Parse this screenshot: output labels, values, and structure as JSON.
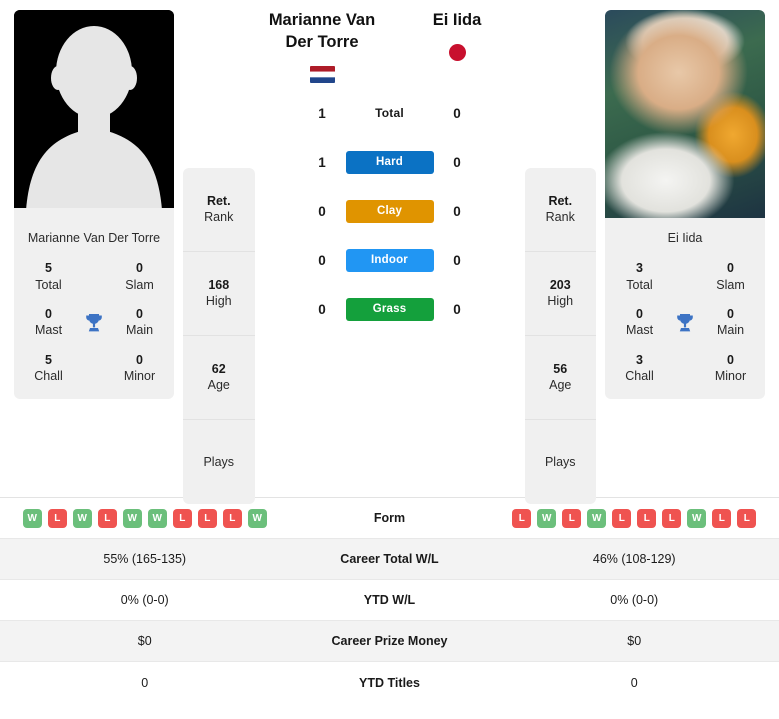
{
  "players": {
    "left": {
      "name": "Marianne Van Der Torre",
      "card_name": "Marianne Van Der Torre",
      "flag": "netherlands-flag",
      "photo": "placeholder-avatar",
      "titles": {
        "total": "5",
        "total_label": "Total",
        "slam": "0",
        "slam_label": "Slam",
        "mast": "0",
        "mast_label": "Mast",
        "main": "0",
        "main_label": "Main",
        "chall": "5",
        "chall_label": "Chall",
        "minor": "0",
        "minor_label": "Minor"
      },
      "info": [
        {
          "value": "Ret.",
          "label": "Rank"
        },
        {
          "value": "168",
          "label": "High"
        },
        {
          "value": "62",
          "label": "Age"
        },
        {
          "value": "",
          "label": "Plays"
        }
      ],
      "form": [
        "W",
        "L",
        "W",
        "L",
        "W",
        "W",
        "L",
        "L",
        "L",
        "W"
      ],
      "career_wl": "55% (165-135)",
      "ytd_wl": "0% (0-0)",
      "prize_money": "$0",
      "ytd_titles": "0"
    },
    "right": {
      "name": "Ei Iida",
      "card_name": "Ei Iida",
      "flag": "japan-flag",
      "photo": "player-photo",
      "titles": {
        "total": "3",
        "total_label": "Total",
        "slam": "0",
        "slam_label": "Slam",
        "mast": "0",
        "mast_label": "Mast",
        "main": "0",
        "main_label": "Main",
        "chall": "3",
        "chall_label": "Chall",
        "minor": "0",
        "minor_label": "Minor"
      },
      "info": [
        {
          "value": "Ret.",
          "label": "Rank"
        },
        {
          "value": "203",
          "label": "High"
        },
        {
          "value": "56",
          "label": "Age"
        },
        {
          "value": "",
          "label": "Plays"
        }
      ],
      "form": [
        "L",
        "W",
        "L",
        "W",
        "L",
        "L",
        "L",
        "W",
        "L",
        "L"
      ],
      "career_wl": "46% (108-129)",
      "ytd_wl": "0% (0-0)",
      "prize_money": "$0",
      "ytd_titles": "0"
    }
  },
  "surfaces": [
    {
      "label": "Total",
      "left": "1",
      "right": "0",
      "color": "",
      "plain": true
    },
    {
      "label": "Hard",
      "left": "1",
      "right": "0",
      "color": "#0b72c4",
      "plain": false
    },
    {
      "label": "Clay",
      "left": "0",
      "right": "0",
      "color": "#e09400",
      "plain": false
    },
    {
      "label": "Indoor",
      "left": "0",
      "right": "0",
      "color": "#2196f3",
      "plain": false
    },
    {
      "label": "Grass",
      "left": "0",
      "right": "0",
      "color": "#14a03c",
      "plain": false
    }
  ],
  "comparison_rows": [
    {
      "label": "Form",
      "left": "",
      "right": "",
      "type": "form"
    },
    {
      "label": "Career Total W/L",
      "left": "55% (165-135)",
      "right": "46% (108-129)",
      "type": "text"
    },
    {
      "label": "YTD W/L",
      "left": "0% (0-0)",
      "right": "0% (0-0)",
      "type": "text"
    },
    {
      "label": "Career Prize Money",
      "left": "$0",
      "right": "$0",
      "type": "text"
    },
    {
      "label": "YTD Titles",
      "left": "0",
      "right": "0",
      "type": "text"
    }
  ],
  "colors": {
    "win": "#6bbf7b",
    "loss": "#ef5350",
    "trophy": "#3d73c4",
    "card_bg": "#f0f0f0",
    "row_alt": "#f3f3f3"
  }
}
